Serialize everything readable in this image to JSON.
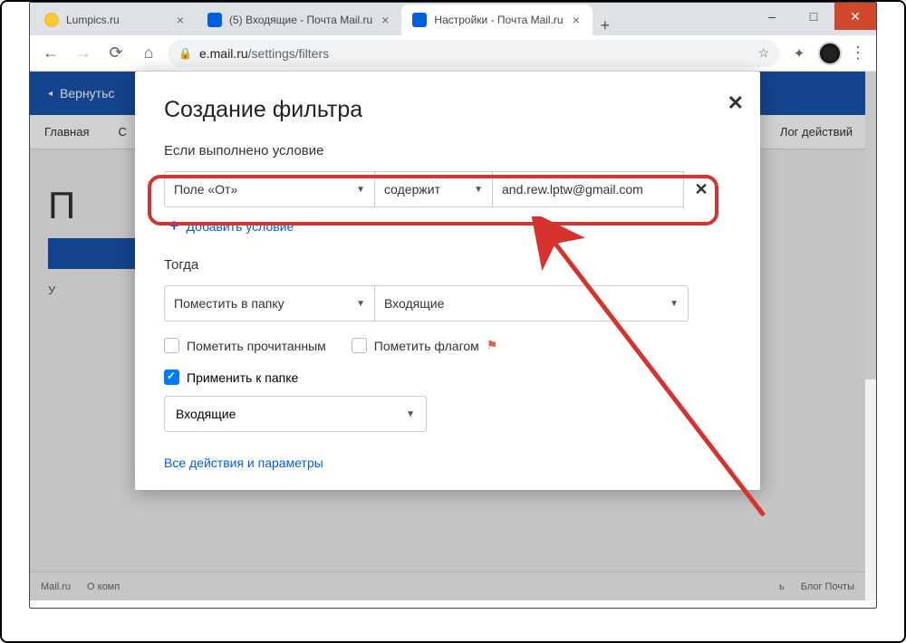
{
  "window": {
    "minimize": "–",
    "maximize": "□",
    "close": "✕"
  },
  "tabs": {
    "t1": {
      "title": "Lumpics.ru"
    },
    "t2": {
      "title": "(5) Входящие - Почта Mail.ru"
    },
    "t3": {
      "title": "Настройки - Почта Mail.ru"
    }
  },
  "addr": {
    "host": "e.mail.ru",
    "path": "/settings/filters"
  },
  "banner": {
    "back": "Вернутьс"
  },
  "nav": {
    "main": "Главная",
    "second": "С",
    "right": "Лог действий"
  },
  "pi": "П",
  "grayline": "У",
  "footer": {
    "a": "Mail.ru",
    "b": "О комп",
    "c": "ь",
    "d": "Блог Почты"
  },
  "modal": {
    "title": "Создание фильтра",
    "cond_label": "Если выполнено условие",
    "field_from": "Поле «От»",
    "contains": "содержит",
    "email": "and.rew.lptw@gmail.com",
    "add_cond": "Добавить условие",
    "then_label": "Тогда",
    "move_to": "Поместить в папку",
    "inbox": "Входящие",
    "mark_read": "Пометить прочитанным",
    "mark_flag": "Пометить флагом",
    "apply_folder": "Применить к папке",
    "folder_sel": "Входящие",
    "all_params": "Все действия и параметры"
  }
}
